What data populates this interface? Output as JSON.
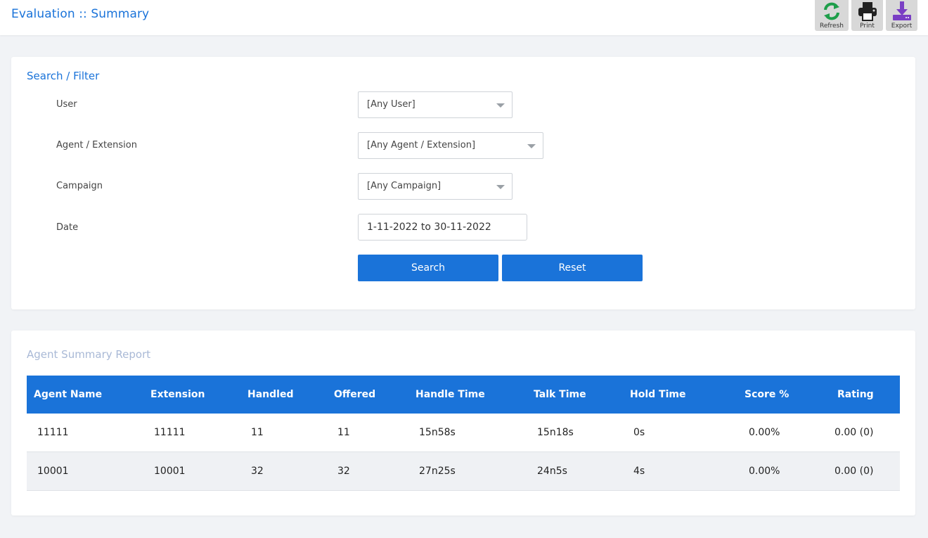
{
  "header": {
    "title": "Evaluation :: Summary",
    "buttons": {
      "refresh": "Refresh",
      "print": "Print",
      "export": "Export"
    }
  },
  "filter": {
    "title": "Search / Filter",
    "user_label": "User",
    "user_value": "[Any User]",
    "agent_label": "Agent / Extension",
    "agent_value": "[Any Agent / Extension]",
    "campaign_label": "Campaign",
    "campaign_value": "[Any Campaign]",
    "date_label": "Date",
    "date_value": "1-11-2022 to 30-11-2022",
    "search_label": "Search",
    "reset_label": "Reset"
  },
  "report": {
    "title": "Agent Summary Report",
    "columns": [
      "Agent Name",
      "Extension",
      "Handled",
      "Offered",
      "Handle Time",
      "Talk Time",
      "Hold Time",
      "Score %",
      "Rating"
    ],
    "rows": [
      [
        "11111",
        "11111",
        "11",
        "11",
        "15n58s",
        "15n18s",
        "0s",
        "0.00%",
        "0.00 (0)"
      ],
      [
        "10001",
        "10001",
        "32",
        "32",
        "27n25s",
        "24n5s",
        "4s",
        "0.00%",
        "0.00 (0)"
      ]
    ]
  },
  "colors": {
    "accent": "#1a73d9",
    "refresh_icon": "#1e9e4a",
    "print_icon": "#222222",
    "export_icon": "#7a3fc4"
  },
  "icons": [
    "refresh-icon",
    "print-icon",
    "export-icon",
    "chevron-down-icon"
  ]
}
